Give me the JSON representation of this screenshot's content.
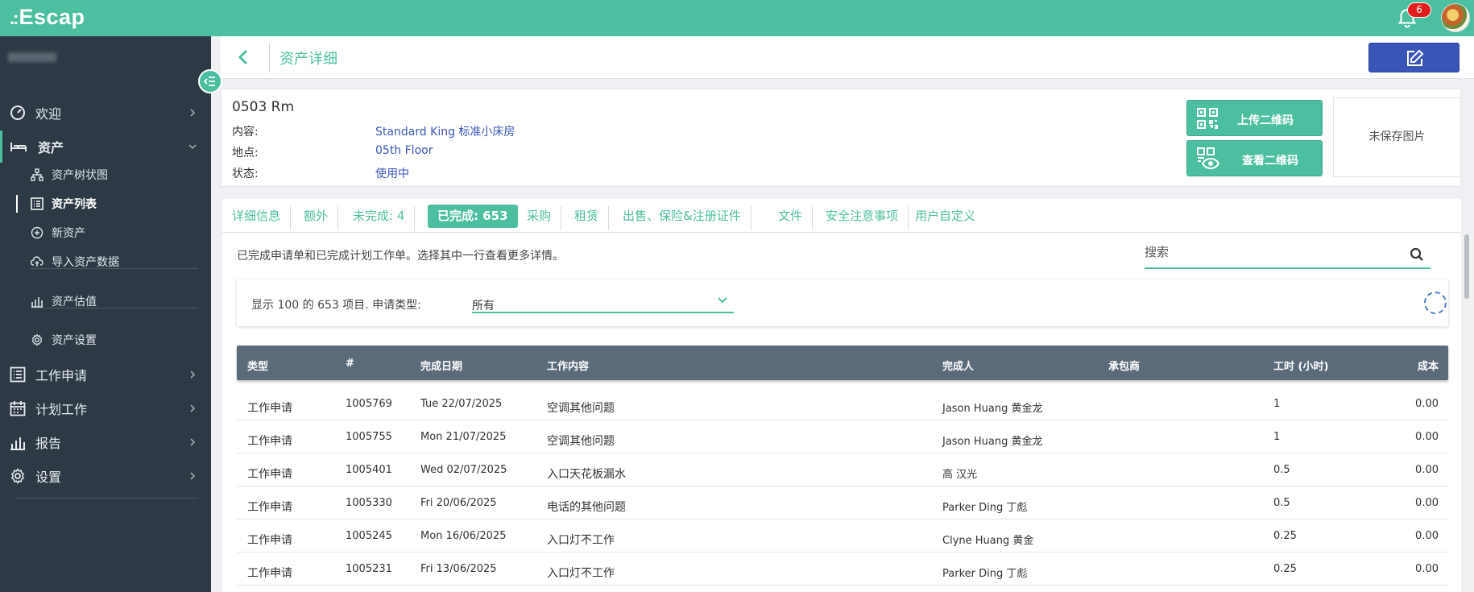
{
  "app": {
    "logo": "Escap",
    "notifications_count": "6"
  },
  "sidebar": {
    "items": [
      {
        "label": "欢迎"
      },
      {
        "label": "资产"
      },
      {
        "label": "工作申请"
      },
      {
        "label": "计划工作"
      },
      {
        "label": "报告"
      },
      {
        "label": "设置"
      }
    ],
    "asset_subitems": [
      {
        "label": "资产树状图"
      },
      {
        "label": "资产列表"
      },
      {
        "label": "新资产"
      },
      {
        "label": "导入资产数据"
      },
      {
        "label": "资产估值"
      },
      {
        "label": "资产设置"
      }
    ]
  },
  "header": {
    "title": "资产详细"
  },
  "asset": {
    "title": "0503 Rm",
    "rows": [
      {
        "key": "内容:",
        "value": "Standard King 标准小床房"
      },
      {
        "key": "地点:",
        "value": "05th Floor"
      },
      {
        "key": "状态:",
        "value": "使用中"
      }
    ],
    "upload_qr_label": "上传二维码",
    "view_qr_label": "查看二维码",
    "photo_placeholder": "未保存图片"
  },
  "tabs": [
    {
      "label": "详细信息"
    },
    {
      "label": "额外"
    },
    {
      "label": "未完成: 4"
    },
    {
      "label": "已完成: 653"
    },
    {
      "label": "采购"
    },
    {
      "label": "租赁"
    },
    {
      "label": "出售、保险&注册证件"
    },
    {
      "label": "文件"
    },
    {
      "label": "安全注意事项"
    },
    {
      "label": "用户自定义"
    }
  ],
  "content": {
    "description": "已完成申请单和已完成计划工作单。选择其中一行查看更多详情。",
    "search_placeholder": "搜索",
    "filter_text": "显示 100 的 653 项目.  申请类型:",
    "filter_value": "所有"
  },
  "table": {
    "headers": {
      "type": "类型",
      "num": "#",
      "date": "完成日期",
      "work": "工作内容",
      "by": "完成人",
      "contractor": "承包商",
      "hours": "工时 (小时)",
      "cost": "成本"
    },
    "rows": [
      {
        "type": "工作申请",
        "num": "1005769",
        "date": "Tue 22/07/2025",
        "work": "空调其他问题",
        "by": "Jason Huang 黄金龙",
        "contractor": "",
        "hours": "1",
        "cost": "0.00"
      },
      {
        "type": "工作申请",
        "num": "1005755",
        "date": "Mon 21/07/2025",
        "work": "空调其他问题",
        "by": "Jason Huang 黄金龙",
        "contractor": "",
        "hours": "1",
        "cost": "0.00"
      },
      {
        "type": "工作申请",
        "num": "1005401",
        "date": "Wed 02/07/2025",
        "work": "入口天花板漏水",
        "by": "高 汉光",
        "contractor": "",
        "hours": "0.5",
        "cost": "0.00"
      },
      {
        "type": "工作申请",
        "num": "1005330",
        "date": "Fri 20/06/2025",
        "work": "电话的其他问题",
        "by": "Parker Ding 丁彪",
        "contractor": "",
        "hours": "0.5",
        "cost": "0.00"
      },
      {
        "type": "工作申请",
        "num": "1005245",
        "date": "Mon 16/06/2025",
        "work": "入口灯不工作",
        "by": "Clyne Huang 黄金",
        "contractor": "",
        "hours": "0.25",
        "cost": "0.00"
      },
      {
        "type": "工作申请",
        "num": "1005231",
        "date": "Fri 13/06/2025",
        "work": "入口灯不工作",
        "by": "Parker Ding 丁彪",
        "contractor": "",
        "hours": "0.25",
        "cost": "0.00"
      }
    ]
  }
}
